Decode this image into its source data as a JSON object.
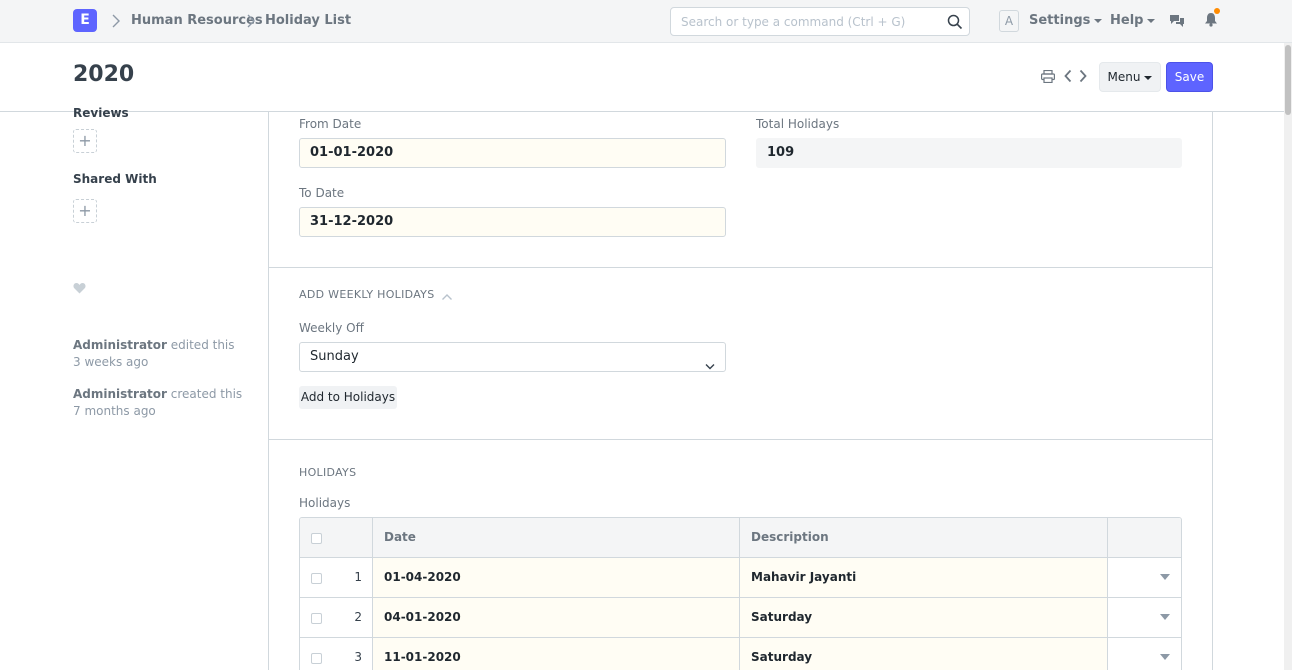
{
  "navbar": {
    "logo_letter": "E",
    "breadcrumbs": [
      "Human Resources",
      "Holiday List"
    ],
    "search_placeholder": "Search or type a command (Ctrl + G)",
    "avatar_letter": "A",
    "settings_label": "Settings",
    "help_label": "Help",
    "notification_color": "#ff8b00"
  },
  "page": {
    "title": "2020",
    "menu_label": "Menu",
    "save_label": "Save",
    "primary_color": "#5e64ff"
  },
  "sidebar": {
    "reviews_label": "Reviews",
    "shared_with_label": "Shared With",
    "add_glyph": "+",
    "activity": [
      {
        "user": "Administrator",
        "action": " edited this",
        "time": "3 weeks ago"
      },
      {
        "user": "Administrator",
        "action": " created this",
        "time": "7 months ago"
      }
    ]
  },
  "form": {
    "from_date_label": "From Date",
    "from_date_value": "01-01-2020",
    "to_date_label": "To Date",
    "to_date_value": "31-12-2020",
    "total_holidays_label": "Total Holidays",
    "total_holidays_value": "109",
    "weekly_section_title": "ADD WEEKLY HOLIDAYS",
    "weekly_off_label": "Weekly Off",
    "weekly_off_value": "Sunday",
    "add_to_holidays_label": "Add to Holidays",
    "holidays_section_title": "HOLIDAYS",
    "holidays_table_label": "Holidays"
  },
  "holidays_table": {
    "columns": [
      "Date",
      "Description"
    ],
    "rows": [
      {
        "idx": "1",
        "date": "01-04-2020",
        "description": "Mahavir Jayanti"
      },
      {
        "idx": "2",
        "date": "04-01-2020",
        "description": "Saturday"
      },
      {
        "idx": "3",
        "date": "11-01-2020",
        "description": "Saturday"
      }
    ]
  }
}
